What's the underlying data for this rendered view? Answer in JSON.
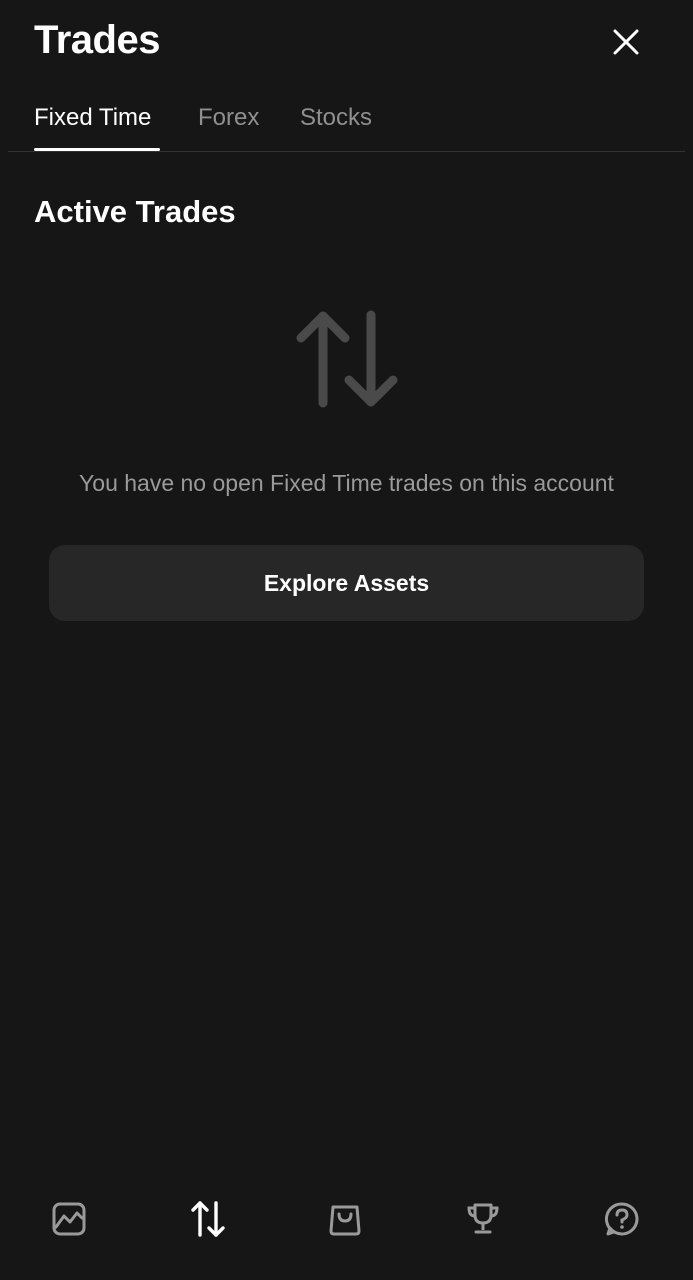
{
  "header": {
    "title": "Trades",
    "close_icon": "close-icon"
  },
  "tabs": [
    {
      "label": "Fixed Time",
      "active": true
    },
    {
      "label": "Forex",
      "active": false
    },
    {
      "label": "Stocks",
      "active": false
    }
  ],
  "main": {
    "section_title": "Active Trades",
    "empty_icon": "up-down-arrows-icon",
    "empty_message": "You have no open Fixed Time trades on this account",
    "explore_button_label": "Explore Assets"
  },
  "bottom_nav": {
    "items": [
      {
        "icon": "chart-icon",
        "active": false
      },
      {
        "icon": "trades-arrows-icon",
        "active": true
      },
      {
        "icon": "shopping-bag-icon",
        "active": false
      },
      {
        "icon": "trophy-icon",
        "active": false
      },
      {
        "icon": "help-icon",
        "active": false
      }
    ]
  },
  "colors": {
    "background": "#161616",
    "text_primary": "#ffffff",
    "text_muted": "#8f8f8f",
    "button_bg": "#272727",
    "icon_muted": "#4a4a4a",
    "nav_icon": "#9a9a9a"
  }
}
